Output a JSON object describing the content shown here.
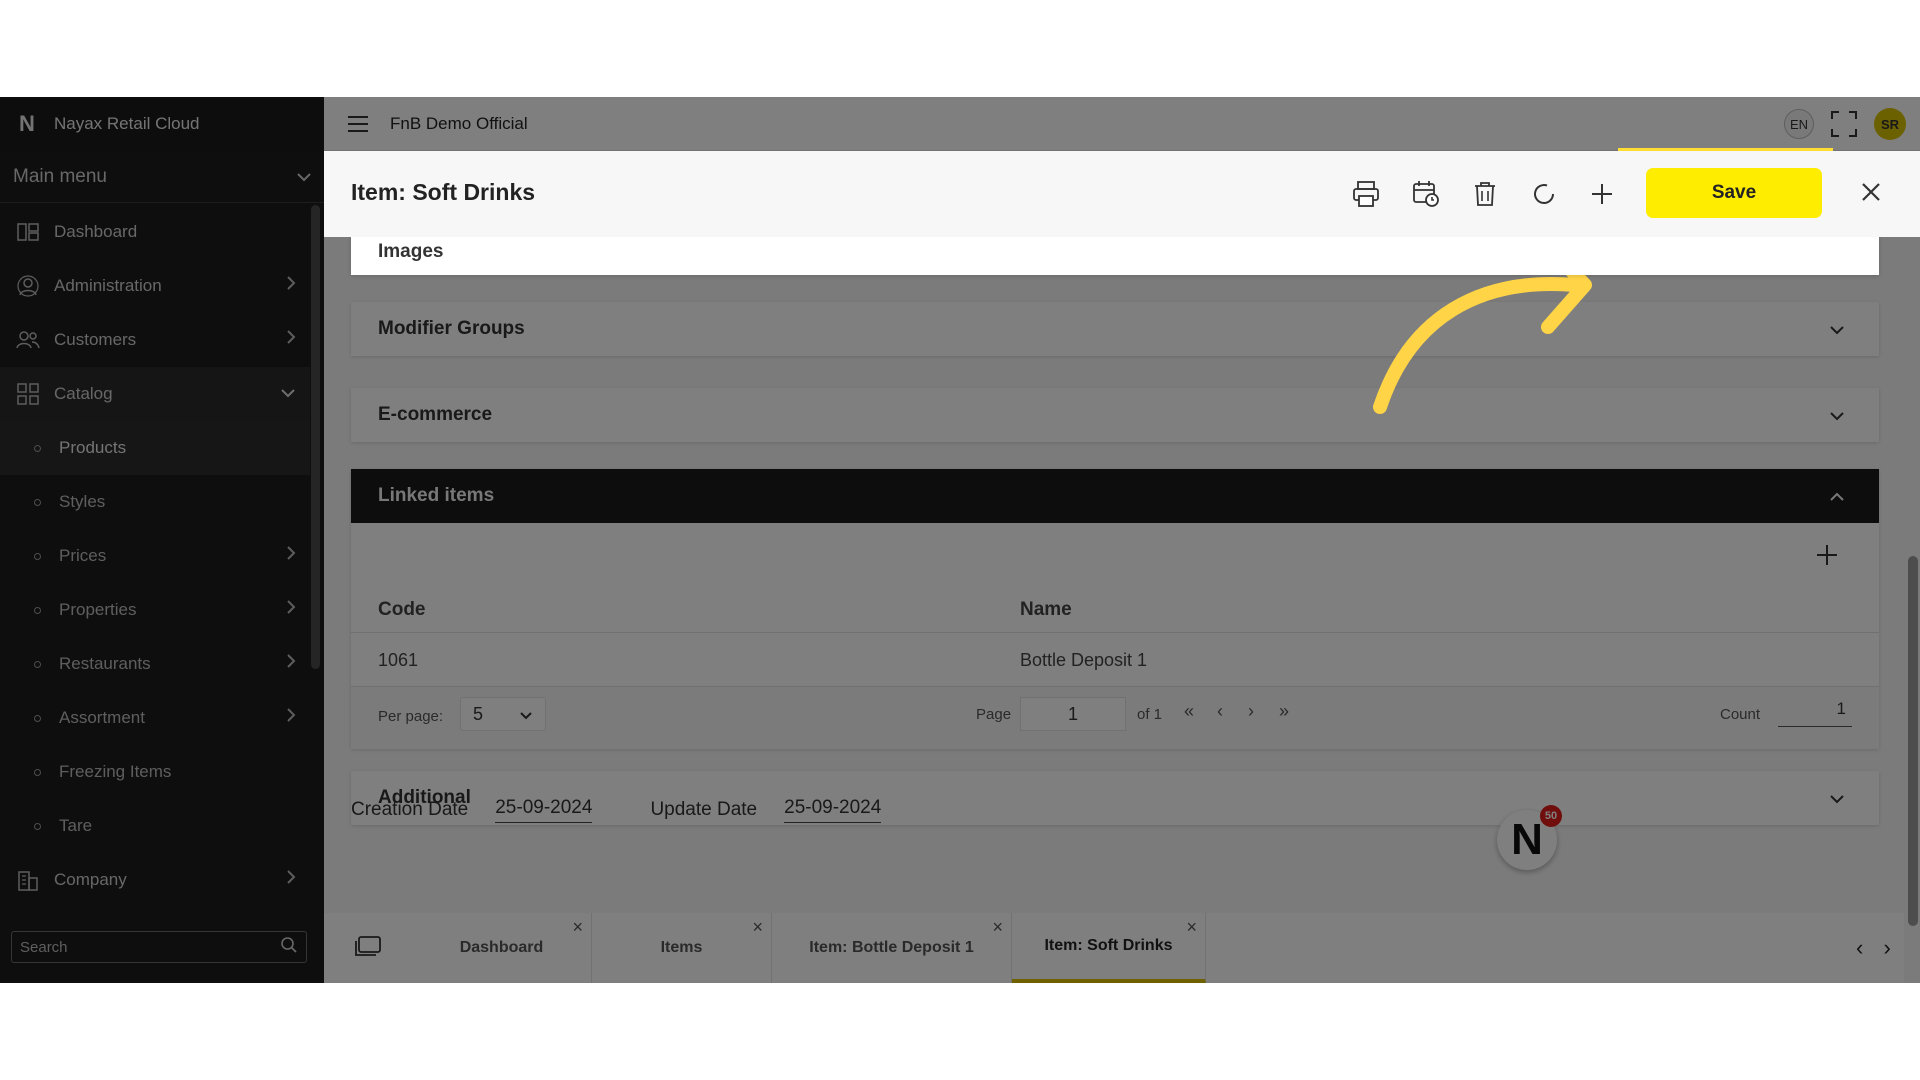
{
  "app": {
    "brand": "Nayax Retail Cloud",
    "company": "FnB Demo Official",
    "language": "EN",
    "user_initials": "SR"
  },
  "sidebar": {
    "main_menu_label": "Main menu",
    "items": [
      {
        "label": "Dashboard"
      },
      {
        "label": "Administration"
      },
      {
        "label": "Customers"
      },
      {
        "label": "Catalog"
      }
    ],
    "catalog_sub": [
      {
        "label": "Products"
      },
      {
        "label": "Styles"
      },
      {
        "label": "Prices"
      },
      {
        "label": "Properties"
      },
      {
        "label": "Restaurants"
      },
      {
        "label": "Assortment"
      },
      {
        "label": "Freezing Items"
      },
      {
        "label": "Tare"
      }
    ],
    "company_label": "Company",
    "search_placeholder": "Search"
  },
  "page": {
    "title": "Item: Soft Drinks",
    "save_label": "Save"
  },
  "sections": {
    "images": "Images",
    "modifier_groups": "Modifier Groups",
    "ecommerce": "E-commerce",
    "linked_items": "Linked items",
    "additional": "Additional"
  },
  "linked_table": {
    "columns": [
      "Code",
      "Name"
    ],
    "rows": [
      {
        "code": "1061",
        "name": "Bottle Deposit 1"
      }
    ],
    "per_page_label": "Per page:",
    "per_page_value": "5",
    "page_label": "Page",
    "page_value": "1",
    "of_label": "of 1",
    "count_label": "Count",
    "count_value": "1"
  },
  "dates": {
    "creation_label": "Creation Date",
    "creation_value": "25-09-2024",
    "update_label": "Update Date",
    "update_value": "25-09-2024"
  },
  "tabs": [
    {
      "label": "Dashboard"
    },
    {
      "label": "Items"
    },
    {
      "label": "Item: Bottle Deposit 1"
    },
    {
      "label": "Item: Soft Drinks"
    }
  ],
  "chat": {
    "badge_count": "50"
  },
  "colors": {
    "accent": "#ffed00",
    "highlight": "#ffdd33",
    "sidebar_bg": "#1d1d1d"
  }
}
